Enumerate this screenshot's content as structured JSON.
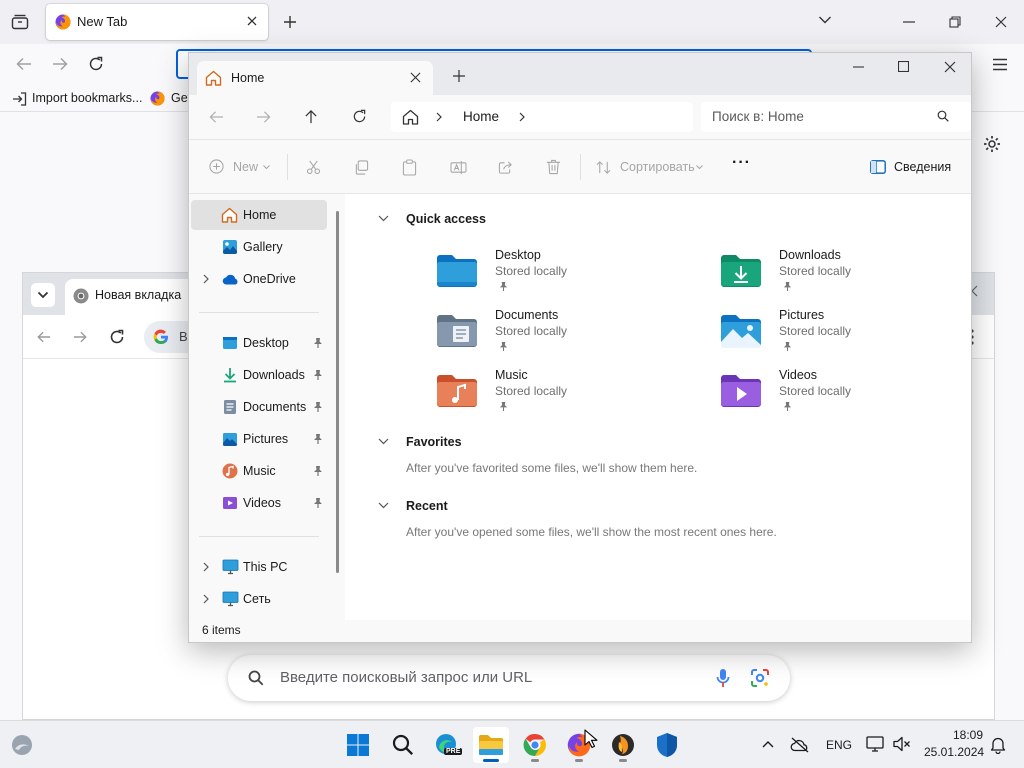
{
  "firefox": {
    "tab_title": "New Tab",
    "bookmarks": [
      {
        "label": "Import bookmarks..."
      },
      {
        "label": "Get"
      }
    ]
  },
  "chrome": {
    "tab_title": "Новая вкладка",
    "omnibox_text": "В",
    "search_placeholder": "Введите поисковый запрос или URL"
  },
  "explorer": {
    "tab_title": "Home",
    "breadcrumb": "Home",
    "search_placeholder": "Поиск в: Home",
    "commands": {
      "new": "New",
      "sort": "Сортировать",
      "more": "···",
      "details": "Сведения"
    },
    "sidebar": {
      "top": [
        {
          "label": "Home",
          "icon": "home-icon",
          "selected": true
        },
        {
          "label": "Gallery",
          "icon": "gallery-icon"
        },
        {
          "label": "OneDrive",
          "icon": "onedrive-icon"
        }
      ],
      "pinned": [
        {
          "label": "Desktop",
          "icon": "desktop-folder-icon"
        },
        {
          "label": "Downloads",
          "icon": "downloads-folder-icon"
        },
        {
          "label": "Documents",
          "icon": "documents-folder-icon"
        },
        {
          "label": "Pictures",
          "icon": "pictures-folder-icon"
        },
        {
          "label": "Music",
          "icon": "music-folder-icon"
        },
        {
          "label": "Videos",
          "icon": "videos-folder-icon"
        }
      ],
      "bottom": [
        {
          "label": "This PC",
          "icon": "this-pc-icon"
        },
        {
          "label": "Сеть",
          "icon": "network-icon"
        }
      ]
    },
    "quick_access": {
      "title": "Quick access",
      "items": [
        {
          "name": "Desktop",
          "sub": "Stored locally"
        },
        {
          "name": "Downloads",
          "sub": "Stored locally"
        },
        {
          "name": "Documents",
          "sub": "Stored locally"
        },
        {
          "name": "Pictures",
          "sub": "Stored locally"
        },
        {
          "name": "Music",
          "sub": "Stored locally"
        },
        {
          "name": "Videos",
          "sub": "Stored locally"
        }
      ]
    },
    "favorites": {
      "title": "Favorites",
      "empty": "After you've favorited some files, we'll show them here."
    },
    "recent": {
      "title": "Recent",
      "empty": "After you've opened some files, we'll show the most recent ones here."
    },
    "status": "6 items"
  },
  "taskbar": {
    "lang": "ENG",
    "time": "18:09",
    "date": "25.01.2024",
    "preview_badge": "PRE"
  },
  "colors": {
    "accent": "#005fb8",
    "firefox_focus": "#0061e0",
    "folder_blue": "#2f9fdc",
    "folder_green": "#1aa67c"
  }
}
